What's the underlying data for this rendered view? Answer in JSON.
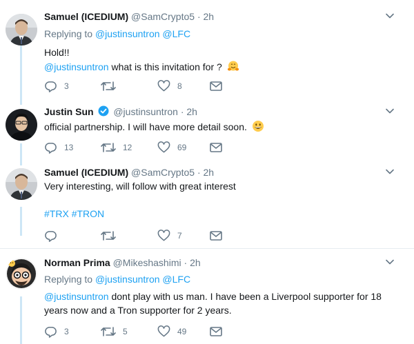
{
  "tweets": [
    {
      "name": "Samuel (ICEDIUM)",
      "handle": "@SamCrypto5",
      "dot": "·",
      "time": "2h",
      "replying_prefix": "Replying to",
      "replying_users": [
        "@justinsuntron",
        "@LFC"
      ],
      "line1": "Hold!!",
      "mention": "@justinsuntron",
      "line2_rest": " what is this invitation for ?",
      "emoji": "hugging-face",
      "reply_count": "3",
      "retweet_count": "",
      "like_count": "8"
    },
    {
      "name": "Justin Sun",
      "verified_icon": "verified-badge-icon",
      "handle": "@justinsuntron",
      "dot": "·",
      "time": "2h",
      "line1": "official partnership. I will have more detail soon.",
      "emoji": "grinning-face",
      "reply_count": "13",
      "retweet_count": "12",
      "like_count": "69"
    },
    {
      "name": "Samuel (ICEDIUM)",
      "handle": "@SamCrypto5",
      "dot": "·",
      "time": "2h",
      "line1": "Very interesting, will follow with great interest",
      "hashtag1": "#TRX",
      "hashtag2": "#TRON",
      "reply_count": "",
      "retweet_count": "",
      "like_count": "7"
    },
    {
      "name": "Norman Prima",
      "handle": "@Mikeshashimi",
      "dot": "·",
      "time": "2h",
      "replying_prefix": "Replying to",
      "replying_users": [
        "@justinsuntron",
        "@LFC"
      ],
      "mention": "@justinsuntron",
      "line1_rest": " dont play with us man. I have been a Liverpool supporter for 18",
      "line2": "years now and a Tron supporter for 2 years.",
      "reply_count": "3",
      "retweet_count": "5",
      "like_count": "49"
    }
  ],
  "colors": {
    "link": "#1da1f2",
    "secondary": "#657786",
    "thread_line": "#cde6f6",
    "separator": "#e6ecf0"
  }
}
